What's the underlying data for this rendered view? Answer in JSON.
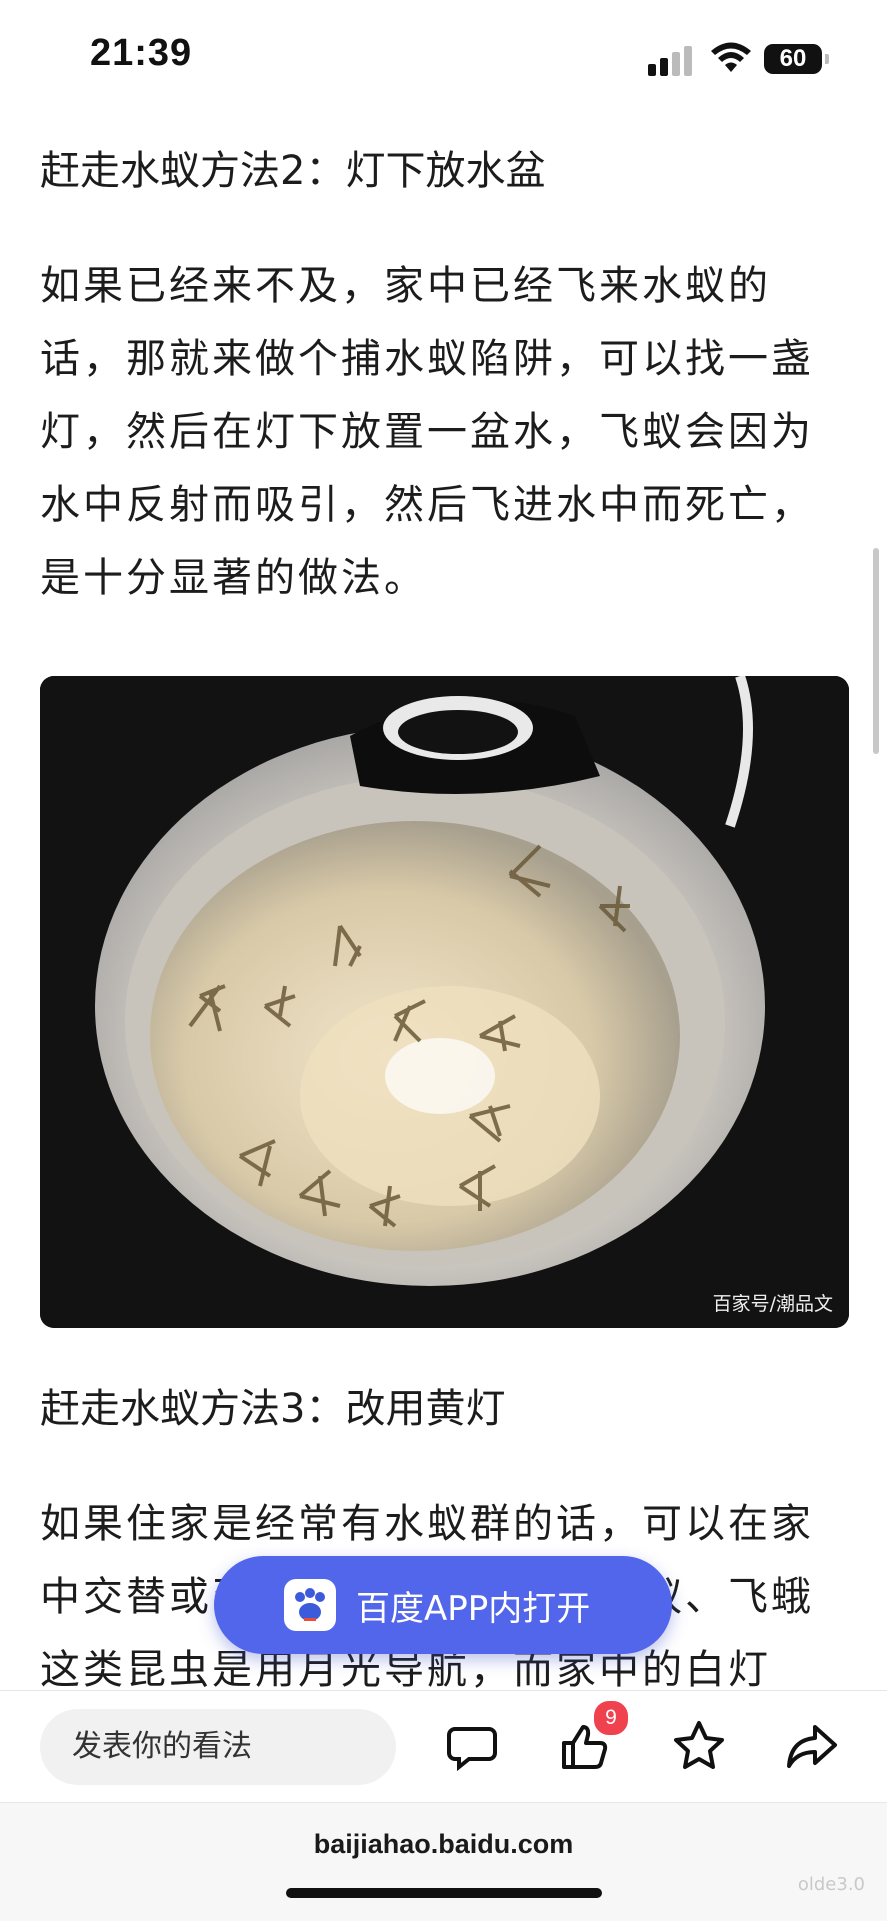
{
  "status": {
    "time": "21:39",
    "battery": "60"
  },
  "article": {
    "heading2": "赶走水蚁方法2：灯下放水盆",
    "para2": "如果已经来不及，家中已经飞来水蚁的话，那就来做个捕水蚁陷阱，可以找一盏灯，然后在灯下放置一盆水，飞蚁会因为水中反射而吸引，然后飞进水中而死亡，是十分显著的做法。",
    "image_watermark": "百家号/潮品文",
    "heading3": "赶走水蚁方法3：改用黄灯",
    "para3": "如果住家是经常有水蚁群的话，可以在家中交替或改用黄色灯泡，因为水蚁、飞蛾这类昆虫是用月光导航，而家中的白灯"
  },
  "open_app": {
    "label": "百度APP内打开",
    "icon": "baidu-paw-icon",
    "color": "#5166ea"
  },
  "bottom_bar": {
    "comment_placeholder": "发表你的看法",
    "like_count": "9",
    "icons": [
      "comment-icon",
      "thumbs-up-icon",
      "star-icon",
      "share-icon"
    ]
  },
  "browser": {
    "url": "baijiahao.baidu.com"
  },
  "corner_mark": "olde3.0"
}
